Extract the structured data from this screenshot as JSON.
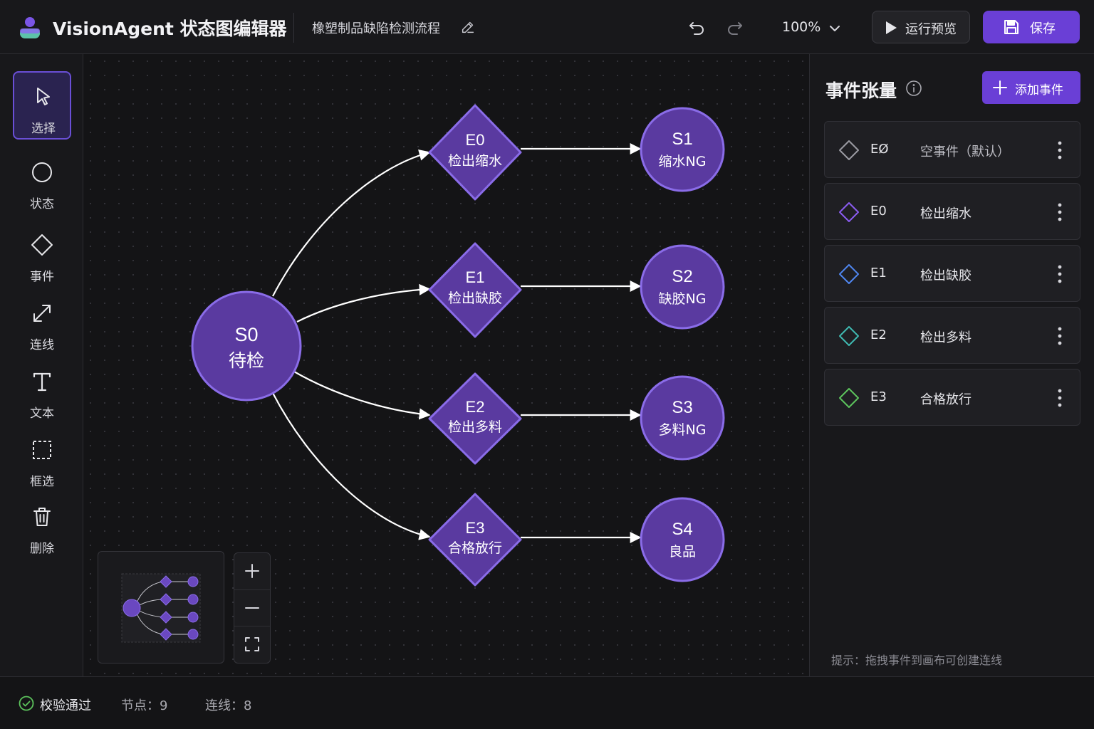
{
  "app": {
    "title": "VisionAgent 状态图编辑器",
    "document_title": "橡塑制品缺陷检测流程"
  },
  "toolbar": {
    "zoom": "100%",
    "run_label": "运行预览",
    "save_label": "保存"
  },
  "tools": [
    {
      "id": "select",
      "label": "选择",
      "icon": "cursor-icon",
      "active": true
    },
    {
      "id": "state",
      "label": "状态",
      "icon": "circle-icon"
    },
    {
      "id": "event",
      "label": "事件",
      "icon": "diamond-icon"
    },
    {
      "id": "connect",
      "label": "连线",
      "icon": "connect-arrow-icon"
    },
    {
      "id": "text",
      "label": "文本",
      "icon": "text-icon"
    },
    {
      "id": "marquee",
      "label": "框选",
      "icon": "marquee-icon"
    },
    {
      "id": "delete",
      "label": "删除",
      "icon": "trash-icon"
    }
  ],
  "diagram": {
    "start": {
      "id": "S0",
      "label": "待检"
    },
    "events": [
      {
        "id": "E0",
        "label": "检出缩水"
      },
      {
        "id": "E1",
        "label": "检出缺胶"
      },
      {
        "id": "E2",
        "label": "检出多料"
      },
      {
        "id": "E3",
        "label": "合格放行"
      }
    ],
    "states": [
      {
        "id": "S1",
        "label": "缩水NG"
      },
      {
        "id": "S2",
        "label": "缺胶NG"
      },
      {
        "id": "S3",
        "label": "多料NG"
      },
      {
        "id": "S4",
        "label": "良品"
      }
    ]
  },
  "panel": {
    "title": "事件张量",
    "add_label": "添加事件",
    "events": [
      {
        "id": "EØ",
        "name": "空事件（默认）",
        "color": "#9a9aa2"
      },
      {
        "id": "E0",
        "name": "检出缩水",
        "color": "#8a5cf0"
      },
      {
        "id": "E1",
        "name": "检出缺胶",
        "color": "#4f86f0"
      },
      {
        "id": "E2",
        "name": "检出多料",
        "color": "#3fb8b0"
      },
      {
        "id": "E3",
        "name": "合格放行",
        "color": "#5cc35c"
      }
    ],
    "hint": "提示：拖拽事件到画布可创建连线"
  },
  "status": {
    "validation": "校验通过",
    "nodes": "节点：9",
    "edges": "连线：8"
  },
  "colors": {
    "accent": "#6a3fd6",
    "node_fill": "#5a3aa0",
    "node_stroke": "#8a6ce8"
  }
}
